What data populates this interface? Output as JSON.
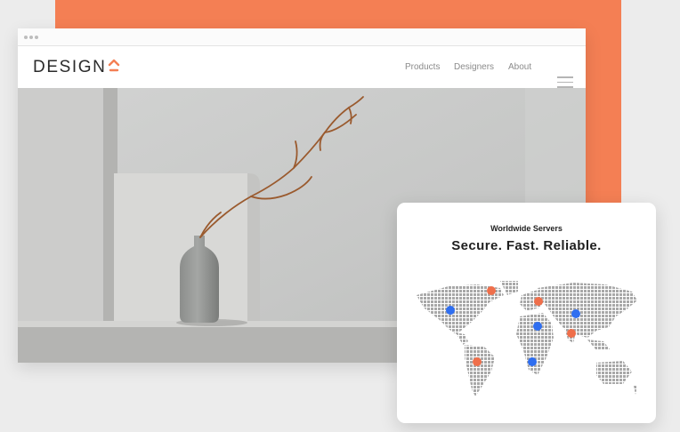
{
  "nav": {
    "logo": "DESIGN",
    "links": [
      "Products",
      "Designers",
      "About"
    ]
  },
  "server_card": {
    "subtitle": "Worldwide Servers",
    "title": "Secure. Fast. Reliable.",
    "marker_colors": {
      "blue": "#2f6ef0",
      "orange": "#ef6f4b"
    }
  },
  "colors": {
    "accent": "#f47f54",
    "page_background": "#ececec"
  }
}
